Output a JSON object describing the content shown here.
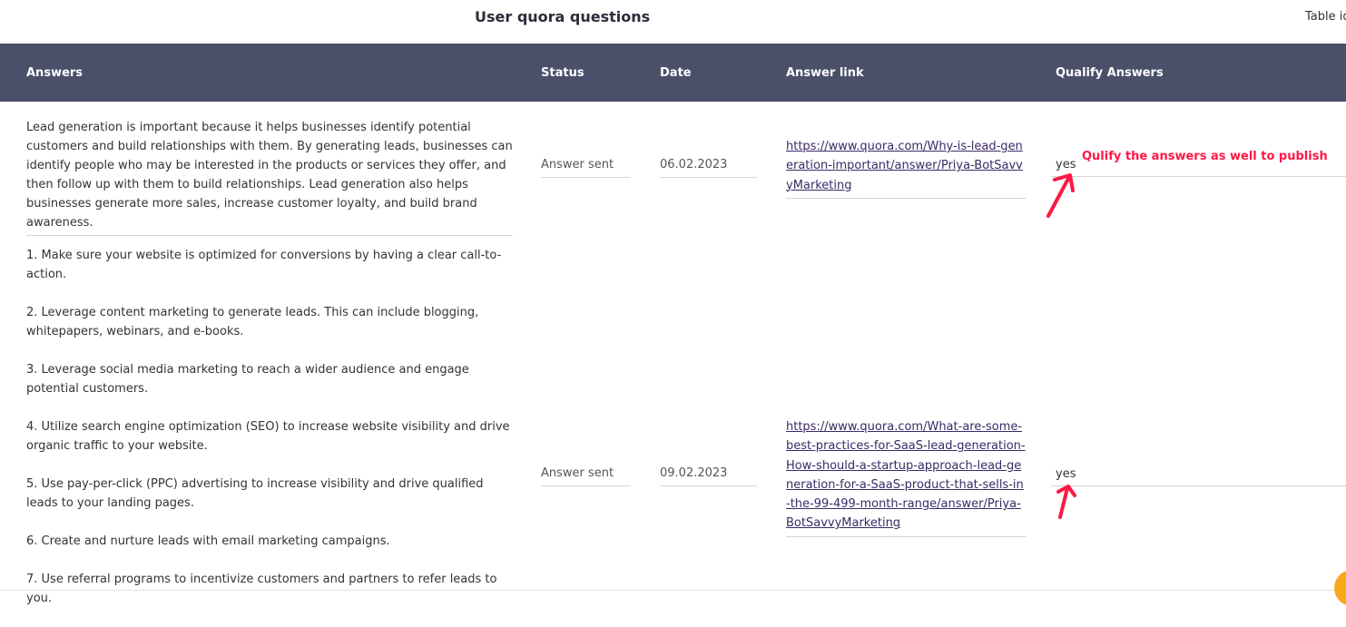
{
  "page": {
    "title": "User quora questions",
    "table_id_label": "Table id"
  },
  "table": {
    "headers": {
      "answers": "Answers",
      "status": "Status",
      "date": "Date",
      "answer_link": "Answer link",
      "qualify": "Qualify Answers"
    },
    "rows": [
      {
        "answer": "Lead generation is important because it helps businesses identify potential customers and build relationships with them. By generating leads, businesses can identify people who may be interested in the products or services they offer, and then follow up with them to build relationships. Lead generation also helps businesses generate more sales, increase customer loyalty, and build brand awareness.",
        "status": "Answer sent",
        "date": "06.02.2023",
        "link": "https://www.quora.com/Why-is-lead-generation-important/answer/Priya-BotSavvyMarketing",
        "qualify": "yes"
      },
      {
        "answer_items": [
          "1. Make sure your website is optimized for conversions by having a clear call-to-action.",
          "2. Leverage content marketing to generate leads. This can include blogging, whitepapers, webinars, and e-books.",
          "3. Leverage social media marketing to reach a wider audience and engage potential customers.",
          "4. Utilize search engine optimization (SEO) to increase website visibility and drive organic traffic to your website.",
          "5. Use pay-per-click (PPC) advertising to increase visibility and drive qualified leads to your landing pages.",
          "6. Create and nurture leads with email marketing campaigns.",
          "7. Use referral programs to incentivize customers and partners to refer leads to you."
        ],
        "status": "Answer sent",
        "date": "09.02.2023",
        "link": "https://www.quora.com/What-are-some-best-practices-for-SaaS-lead-generation-How-should-a-startup-approach-lead-generation-for-a-SaaS-product-that-sells-in-the-99-499-month-range/answer/Priya-BotSavvyMarketing",
        "qualify": "yes"
      }
    ]
  },
  "annotation": {
    "text": "Qulify the answers as well to publish",
    "color": "#ff1744"
  },
  "colors": {
    "header_bg": "#4a4f6a",
    "link": "#3a2a66",
    "chat_bubble": "#f7a81b"
  },
  "icons": {
    "arrow": "arrow-up-right-icon",
    "chat": "chat-widget-icon"
  }
}
